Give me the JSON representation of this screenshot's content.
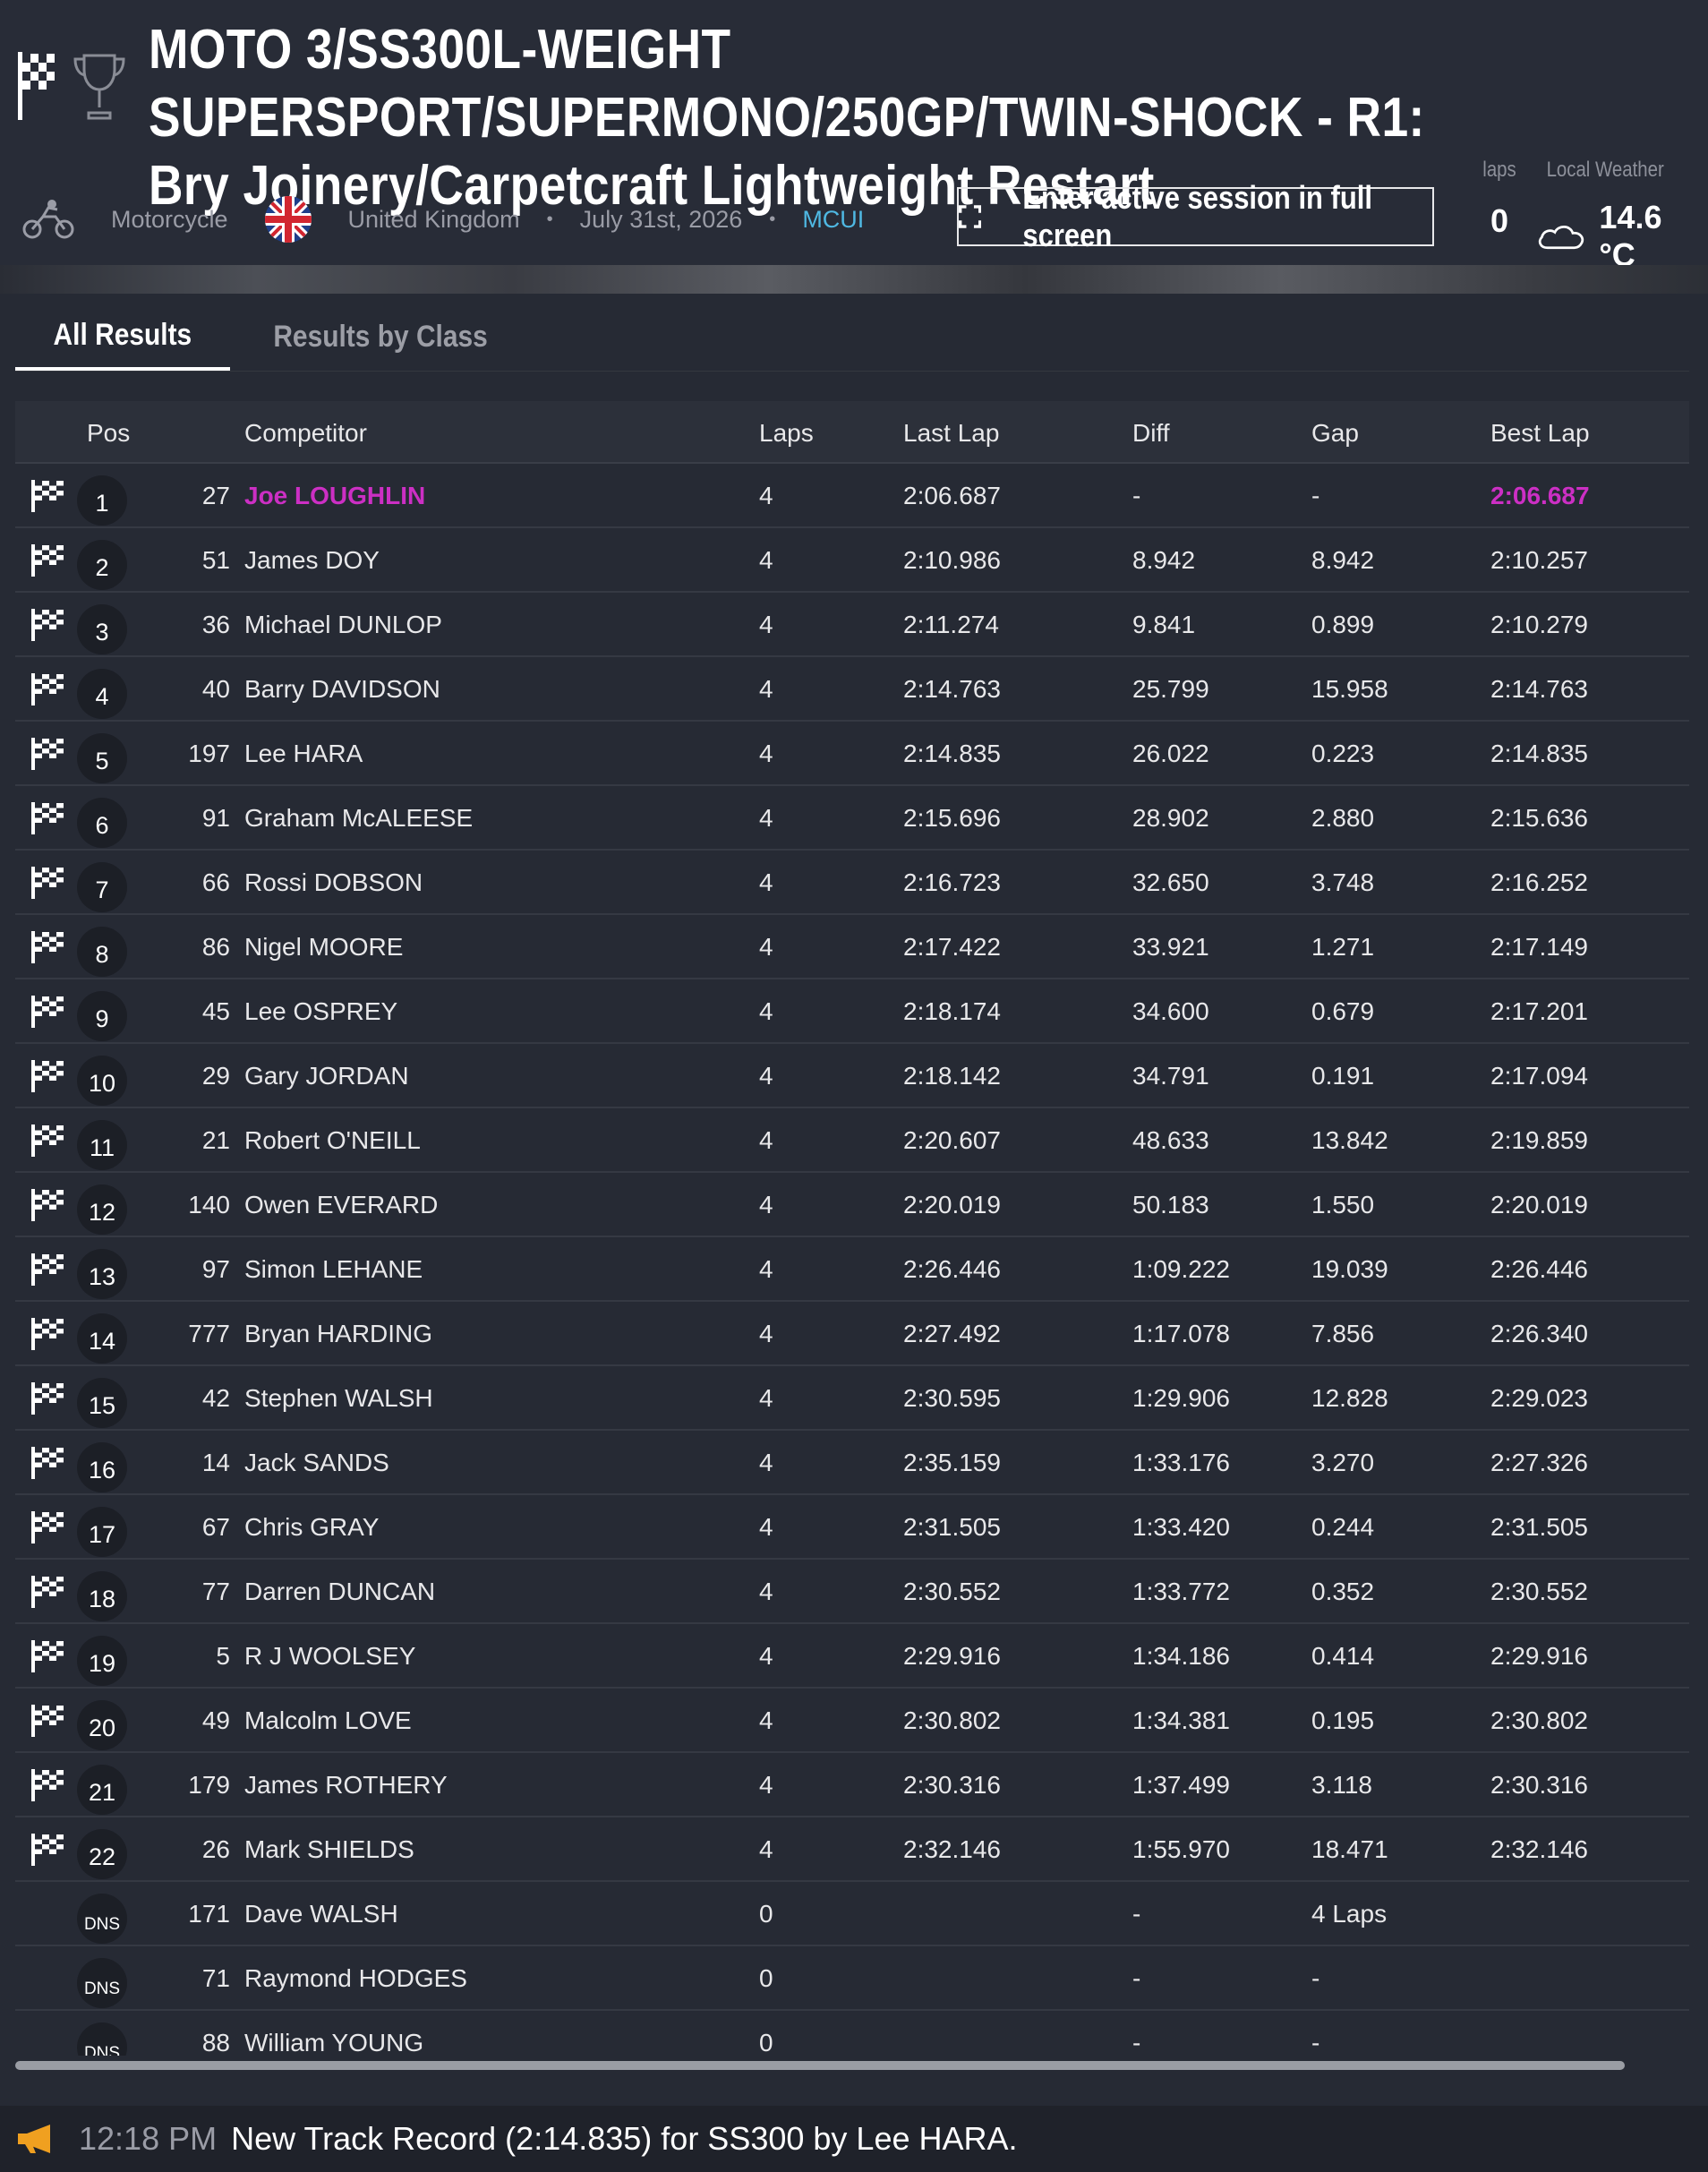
{
  "header": {
    "title": "MOTO 3/SS300L-WEIGHT SUPERSPORT/SUPERMONO/250GP/TWIN-SHOCK - R1: Bry Joinery/Carpetcraft Lightweight Restart",
    "sport": "Motorcycle",
    "country": "United Kingdom",
    "date": "July 31st, 2026",
    "organizer": "MCUI",
    "fullscreen_label": "Enter active session in full screen",
    "laps_label": "laps",
    "laps_value": "0",
    "weather_label": "Local Weather",
    "weather_value": "14.6 °C"
  },
  "tabs": [
    {
      "label": "All Results",
      "active": true
    },
    {
      "label": "Results by Class",
      "active": false
    }
  ],
  "columns": {
    "pos": "Pos",
    "competitor": "Competitor",
    "laps": "Laps",
    "last_lap": "Last Lap",
    "diff": "Diff",
    "gap": "Gap",
    "best_lap": "Best Lap"
  },
  "rows": [
    {
      "pos": "1",
      "num": "27",
      "name": "Joe LOUGHLIN",
      "laps": "4",
      "last": "2:06.687",
      "diff": "-",
      "gap": "-",
      "best": "2:06.687",
      "flag": true,
      "highlight": true
    },
    {
      "pos": "2",
      "num": "51",
      "name": "James DOY",
      "laps": "4",
      "last": "2:10.986",
      "diff": "8.942",
      "gap": "8.942",
      "best": "2:10.257",
      "flag": true
    },
    {
      "pos": "3",
      "num": "36",
      "name": "Michael DUNLOP",
      "laps": "4",
      "last": "2:11.274",
      "diff": "9.841",
      "gap": "0.899",
      "best": "2:10.279",
      "flag": true
    },
    {
      "pos": "4",
      "num": "40",
      "name": "Barry DAVIDSON",
      "laps": "4",
      "last": "2:14.763",
      "diff": "25.799",
      "gap": "15.958",
      "best": "2:14.763",
      "flag": true
    },
    {
      "pos": "5",
      "num": "197",
      "name": "Lee HARA",
      "laps": "4",
      "last": "2:14.835",
      "diff": "26.022",
      "gap": "0.223",
      "best": "2:14.835",
      "flag": true
    },
    {
      "pos": "6",
      "num": "91",
      "name": "Graham McALEESE",
      "laps": "4",
      "last": "2:15.696",
      "diff": "28.902",
      "gap": "2.880",
      "best": "2:15.636",
      "flag": true
    },
    {
      "pos": "7",
      "num": "66",
      "name": "Rossi DOBSON",
      "laps": "4",
      "last": "2:16.723",
      "diff": "32.650",
      "gap": "3.748",
      "best": "2:16.252",
      "flag": true
    },
    {
      "pos": "8",
      "num": "86",
      "name": "Nigel MOORE",
      "laps": "4",
      "last": "2:17.422",
      "diff": "33.921",
      "gap": "1.271",
      "best": "2:17.149",
      "flag": true
    },
    {
      "pos": "9",
      "num": "45",
      "name": "Lee OSPREY",
      "laps": "4",
      "last": "2:18.174",
      "diff": "34.600",
      "gap": "0.679",
      "best": "2:17.201",
      "flag": true
    },
    {
      "pos": "10",
      "num": "29",
      "name": "Gary JORDAN",
      "laps": "4",
      "last": "2:18.142",
      "diff": "34.791",
      "gap": "0.191",
      "best": "2:17.094",
      "flag": true
    },
    {
      "pos": "11",
      "num": "21",
      "name": "Robert O'NEILL",
      "laps": "4",
      "last": "2:20.607",
      "diff": "48.633",
      "gap": "13.842",
      "best": "2:19.859",
      "flag": true
    },
    {
      "pos": "12",
      "num": "140",
      "name": "Owen EVERARD",
      "laps": "4",
      "last": "2:20.019",
      "diff": "50.183",
      "gap": "1.550",
      "best": "2:20.019",
      "flag": true
    },
    {
      "pos": "13",
      "num": "97",
      "name": "Simon LEHANE",
      "laps": "4",
      "last": "2:26.446",
      "diff": "1:09.222",
      "gap": "19.039",
      "best": "2:26.446",
      "flag": true
    },
    {
      "pos": "14",
      "num": "777",
      "name": "Bryan HARDING",
      "laps": "4",
      "last": "2:27.492",
      "diff": "1:17.078",
      "gap": "7.856",
      "best": "2:26.340",
      "flag": true
    },
    {
      "pos": "15",
      "num": "42",
      "name": "Stephen WALSH",
      "laps": "4",
      "last": "2:30.595",
      "diff": "1:29.906",
      "gap": "12.828",
      "best": "2:29.023",
      "flag": true
    },
    {
      "pos": "16",
      "num": "14",
      "name": "Jack SANDS",
      "laps": "4",
      "last": "2:35.159",
      "diff": "1:33.176",
      "gap": "3.270",
      "best": "2:27.326",
      "flag": true
    },
    {
      "pos": "17",
      "num": "67",
      "name": "Chris GRAY",
      "laps": "4",
      "last": "2:31.505",
      "diff": "1:33.420",
      "gap": "0.244",
      "best": "2:31.505",
      "flag": true
    },
    {
      "pos": "18",
      "num": "77",
      "name": "Darren DUNCAN",
      "laps": "4",
      "last": "2:30.552",
      "diff": "1:33.772",
      "gap": "0.352",
      "best": "2:30.552",
      "flag": true
    },
    {
      "pos": "19",
      "num": "5",
      "name": "R J WOOLSEY",
      "laps": "4",
      "last": "2:29.916",
      "diff": "1:34.186",
      "gap": "0.414",
      "best": "2:29.916",
      "flag": true
    },
    {
      "pos": "20",
      "num": "49",
      "name": "Malcolm LOVE",
      "laps": "4",
      "last": "2:30.802",
      "diff": "1:34.381",
      "gap": "0.195",
      "best": "2:30.802",
      "flag": true
    },
    {
      "pos": "21",
      "num": "179",
      "name": "James ROTHERY",
      "laps": "4",
      "last": "2:30.316",
      "diff": "1:37.499",
      "gap": "3.118",
      "best": "2:30.316",
      "flag": true
    },
    {
      "pos": "22",
      "num": "26",
      "name": "Mark SHIELDS",
      "laps": "4",
      "last": "2:32.146",
      "diff": "1:55.970",
      "gap": "18.471",
      "best": "2:32.146",
      "flag": true
    },
    {
      "pos": "DNS",
      "num": "171",
      "name": "Dave WALSH",
      "laps": "0",
      "last": "",
      "diff": "-",
      "gap": "4 Laps",
      "best": "",
      "flag": false
    },
    {
      "pos": "DNS",
      "num": "71",
      "name": "Raymond HODGES",
      "laps": "0",
      "last": "",
      "diff": "-",
      "gap": "-",
      "best": "",
      "flag": false
    },
    {
      "pos": "DNS",
      "num": "88",
      "name": "William YOUNG",
      "laps": "0",
      "last": "",
      "diff": "-",
      "gap": "-",
      "best": "",
      "flag": false
    }
  ],
  "ticker": {
    "time": "12:18 PM",
    "message": "New Track Record (2:14.835) for SS300 by Lee HARA."
  },
  "colors": {
    "highlight": "#cc2fc4",
    "link": "#4fb8e2",
    "background": "#262a34"
  }
}
